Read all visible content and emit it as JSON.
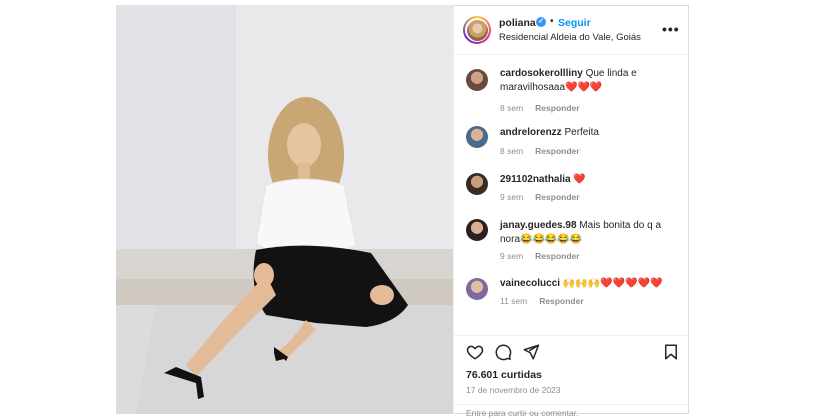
{
  "post": {
    "username": "poliana",
    "follow_label": "Seguir",
    "separator": "•",
    "location": "Residencial Aldeia do Vale, Goiás",
    "more_label": "•••",
    "verified_glyph": "✓"
  },
  "comments": [
    {
      "user": "cardosokerollliny",
      "text": " Que linda e maravilhosaaa❤️❤️❤️",
      "time": "8 sem",
      "reply": "Responder"
    },
    {
      "user": "andrelorenzz",
      "text": " Perfeita",
      "time": "8 sem",
      "reply": "Responder"
    },
    {
      "user": "291102nathalia",
      "text": " ❤️",
      "time": "9 sem",
      "reply": "Responder"
    },
    {
      "user": "janay.guedes.98",
      "text": " Mais bonita do q a nora😂😂😂😂😂",
      "time": "9 sem",
      "reply": "Responder"
    },
    {
      "user": "vainecolucci",
      "text": " 🙌🙌🙌❤️❤️❤️❤️❤️",
      "time": "11 sem",
      "reply": "Responder"
    }
  ],
  "footer": {
    "likes": "76.601 curtidas",
    "date": "17 de novembro de 2023",
    "add_comment_placeholder": "Entre para curtir ou comentar."
  },
  "icons": {
    "like": "heart-icon",
    "comment": "comment-icon",
    "share": "send-icon",
    "save": "bookmark-icon"
  },
  "colors": {
    "link_blue": "#0095f6",
    "verified_blue": "#3897f0",
    "muted": "#8e8e8e",
    "text": "#262626"
  }
}
